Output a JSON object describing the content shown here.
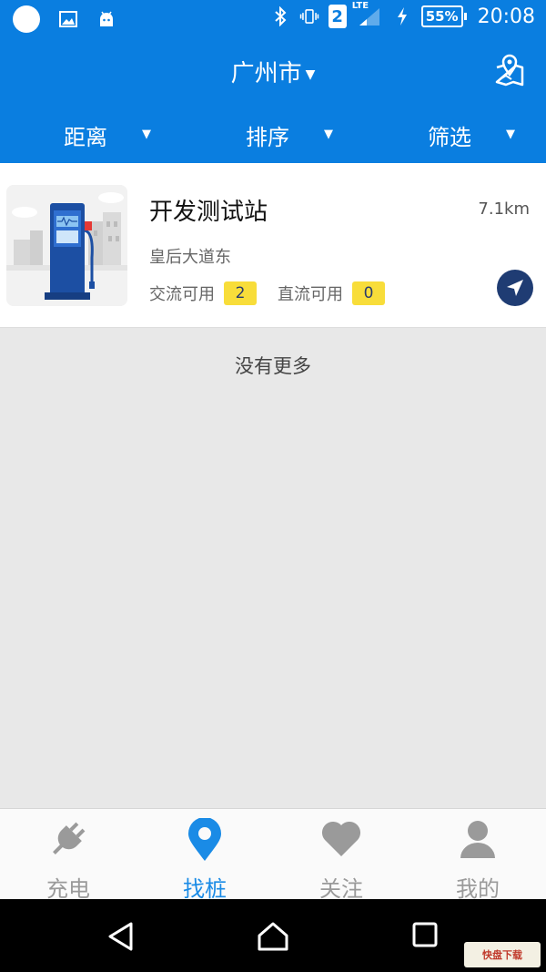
{
  "status_bar": {
    "sim_slot": "2",
    "network": "LTE",
    "battery": "55%",
    "time": "20:08"
  },
  "header": {
    "city": "广州市",
    "map_icon": "map-pin-icon"
  },
  "filters": [
    {
      "label": "距离"
    },
    {
      "label": "排序"
    },
    {
      "label": "筛选"
    }
  ],
  "stations": [
    {
      "name": "开发测试站",
      "distance": "7.1km",
      "address": "皇后大道东",
      "ac_label": "交流可用",
      "ac_count": "2",
      "dc_label": "直流可用",
      "dc_count": "0"
    }
  ],
  "list_footer": "没有更多",
  "tabs": [
    {
      "label": "充电",
      "icon": "plug-icon",
      "active": false
    },
    {
      "label": "找桩",
      "icon": "location-pin-icon",
      "active": true
    },
    {
      "label": "关注",
      "icon": "heart-icon",
      "active": false
    },
    {
      "label": "我的",
      "icon": "user-icon",
      "active": false
    }
  ],
  "colors": {
    "primary": "#0a7ee0",
    "active_tab": "#1a8be6",
    "count_badge": "#f8dd3a",
    "nav_button": "#1f3c73"
  }
}
